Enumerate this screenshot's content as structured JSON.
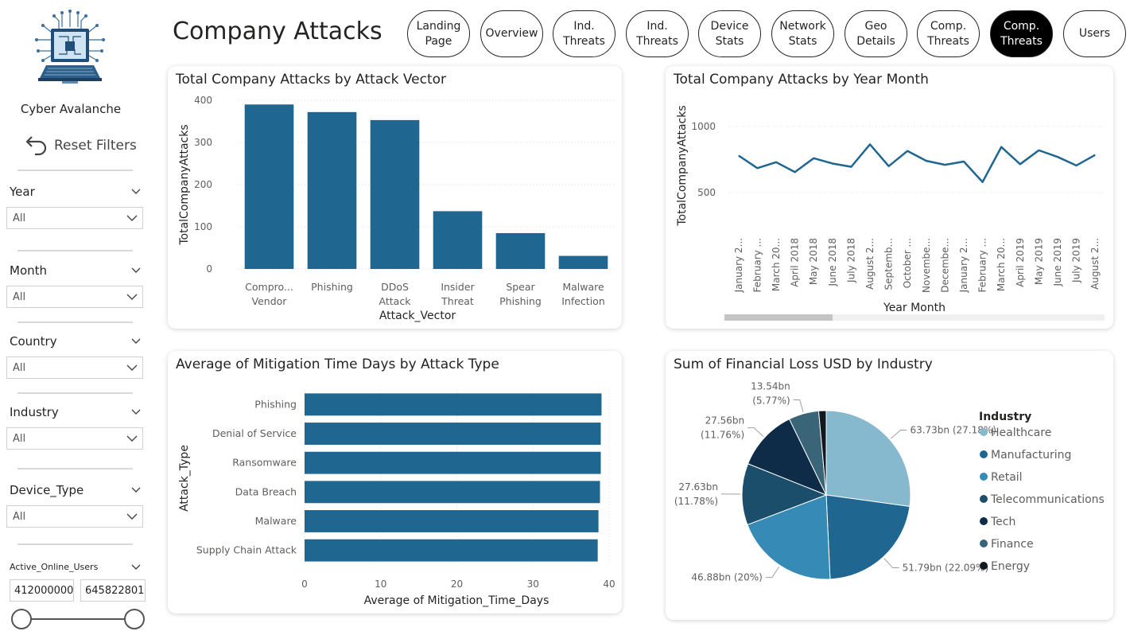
{
  "sidebar": {
    "brand": "Cyber Avalanche",
    "reset_label": "Reset Filters",
    "slicers": [
      {
        "title": "Year",
        "value": "All"
      },
      {
        "title": "Month",
        "value": "All"
      },
      {
        "title": "Country",
        "value": "All"
      },
      {
        "title": "Industry",
        "value": "All"
      },
      {
        "title": "Device_Type",
        "value": "All"
      }
    ],
    "range": {
      "title": "Active_Online_Users",
      "min": "412000000",
      "max": "645822801"
    }
  },
  "header": {
    "title": "Company Attacks",
    "nav": [
      {
        "label": "Landing\nPage",
        "active": false
      },
      {
        "label": "Overview",
        "active": false
      },
      {
        "label": "Ind.\nThreats",
        "active": false
      },
      {
        "label": "Ind.\nThreats",
        "active": false
      },
      {
        "label": "Device\nStats",
        "active": false
      },
      {
        "label": "Network\nStats",
        "active": false
      },
      {
        "label": "Geo\nDetails",
        "active": false
      },
      {
        "label": "Comp.\nThreats",
        "active": false
      },
      {
        "label": "Comp.\nThreats",
        "active": true
      },
      {
        "label": "Users",
        "active": false
      }
    ]
  },
  "colors": {
    "bar": "#1f6690",
    "pie": [
      "#86b9cd",
      "#1f6690",
      "#368ab6",
      "#1b4e6b",
      "#0e2b47",
      "#3a6478",
      "#111820"
    ]
  },
  "chart_data": [
    {
      "type": "bar",
      "title": "Total Company Attacks by Attack Vector",
      "xlabel": "Attack_Vector",
      "ylabel": "TotalCompanyAttacks",
      "categories": [
        [
          "Compro...",
          "Vendor"
        ],
        [
          "Phishing"
        ],
        [
          "DDoS",
          "Attack"
        ],
        [
          "Insider",
          "Threat"
        ],
        [
          "Spear",
          "Phishing"
        ],
        [
          "Malware",
          "Infection"
        ]
      ],
      "values": [
        390,
        372,
        353,
        137,
        85,
        31
      ],
      "ylim": [
        0,
        400
      ],
      "yticks": [
        "0",
        "100",
        "200",
        "300",
        "400"
      ],
      "grid": true
    },
    {
      "type": "line",
      "title": "Total Company Attacks by Year Month",
      "xlabel": "Year Month",
      "ylabel": "TotalCompanyAttacks",
      "x": [
        "January 2...",
        "February ...",
        "March 20...",
        "April 2018",
        "May 2018",
        "June 2018",
        "July 2018",
        "August 2...",
        "Septemb...",
        "October ...",
        "Novembe...",
        "Decembe...",
        "January 2...",
        "February ...",
        "March 20...",
        "April 2019",
        "May 2019",
        "June 2019",
        "July 2019",
        "August 2..."
      ],
      "values": [
        780,
        685,
        730,
        655,
        760,
        720,
        695,
        865,
        700,
        815,
        740,
        710,
        735,
        580,
        845,
        715,
        820,
        770,
        705,
        785
      ],
      "yticks": [
        "500",
        "1000"
      ],
      "grid": true
    },
    {
      "type": "bar",
      "orientation": "horizontal",
      "title": "Average of Mitigation Time Days by Attack Type",
      "xlabel": "Average of Mitigation_Time_Days",
      "ylabel": "Attack_Type",
      "categories": [
        "Phishing",
        "Denial of Service",
        "Ransomware",
        "Data Breach",
        "Malware",
        "Supply Chain Attack"
      ],
      "values": [
        39.0,
        38.9,
        38.9,
        38.8,
        38.6,
        38.5
      ],
      "xlim": [
        0,
        40
      ],
      "xticks": [
        "0",
        "10",
        "20",
        "30",
        "40"
      ],
      "grid": true
    },
    {
      "type": "pie",
      "title": "Sum of Financial Loss USD by Industry",
      "legend_title": "Industry",
      "legend_placement": "right",
      "labels": [
        "Healthcare",
        "Manufacturing",
        "Retail",
        "Telecommunications",
        "Tech",
        "Finance",
        "Energy"
      ],
      "values": [
        63.73,
        51.79,
        46.88,
        27.63,
        27.56,
        13.54,
        3.37
      ],
      "data_labels": [
        [
          "63.73bn (27.18%)"
        ],
        [
          "51.79bn (22.09%)"
        ],
        [
          "46.88bn (20%)"
        ],
        [
          "27.63bn",
          "(11.78%)"
        ],
        [
          "27.56bn",
          "(11.76%)"
        ],
        [
          "13.54bn",
          "(5.77%)"
        ],
        []
      ]
    }
  ]
}
